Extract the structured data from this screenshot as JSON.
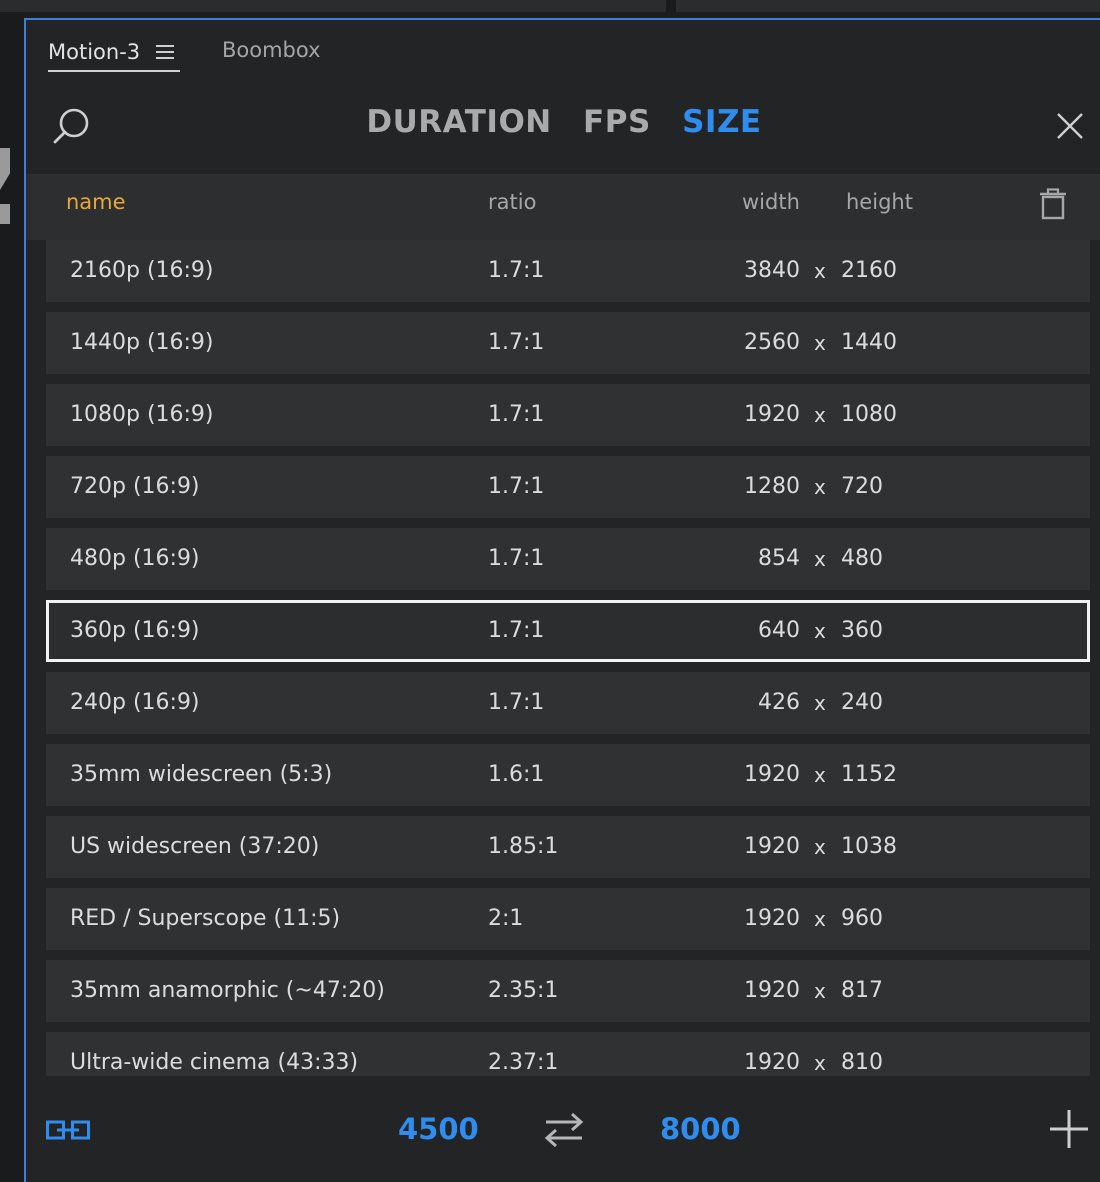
{
  "tabs": {
    "active": "Motion-3",
    "inactive": "Boombox"
  },
  "heading": {
    "duration": "DURATION",
    "fps": "FPS",
    "size": "SIZE"
  },
  "columns": {
    "name": "name",
    "ratio": "ratio",
    "width": "width",
    "height": "height"
  },
  "rows": [
    {
      "name": "2160p (16:9)",
      "ratio": "1.7:1",
      "width": "3840",
      "x": "x",
      "height": "2160"
    },
    {
      "name": "1440p (16:9)",
      "ratio": "1.7:1",
      "width": "2560",
      "x": "x",
      "height": "1440"
    },
    {
      "name": "1080p (16:9)",
      "ratio": "1.7:1",
      "width": "1920",
      "x": "x",
      "height": "1080"
    },
    {
      "name": "720p (16:9)",
      "ratio": "1.7:1",
      "width": "1280",
      "x": "x",
      "height": "720"
    },
    {
      "name": "480p (16:9)",
      "ratio": "1.7:1",
      "width": "854",
      "x": "x",
      "height": "480"
    },
    {
      "name": "360p (16:9)",
      "ratio": "1.7:1",
      "width": "640",
      "x": "x",
      "height": "360"
    },
    {
      "name": "240p (16:9)",
      "ratio": "1.7:1",
      "width": "426",
      "x": "x",
      "height": "240"
    },
    {
      "name": "35mm widescreen (5:3)",
      "ratio": "1.6:1",
      "width": "1920",
      "x": "x",
      "height": "1152"
    },
    {
      "name": "US widescreen (37:20)",
      "ratio": "1.85:1",
      "width": "1920",
      "x": "x",
      "height": "1038"
    },
    {
      "name": "RED / Superscope (11:5)",
      "ratio": "2:1",
      "width": "1920",
      "x": "x",
      "height": "960"
    },
    {
      "name": "35mm anamorphic (~47:20)",
      "ratio": "2.35:1",
      "width": "1920",
      "x": "x",
      "height": "817"
    },
    {
      "name": "Ultra-wide cinema (43:33)",
      "ratio": "2.37:1",
      "width": "1920",
      "x": "x",
      "height": "810"
    }
  ],
  "footer": {
    "width_value": "4500",
    "height_value": "8000"
  },
  "icons": {
    "search": "search-icon",
    "close": "close-icon",
    "trash": "trash-icon",
    "menu": "menu-icon",
    "link": "link-icon",
    "swap": "swap-icon",
    "add": "plus-icon"
  },
  "colors": {
    "accent": "#2f8df0",
    "name_header": "#e7a83a",
    "panel_border": "#3d7fd8",
    "selection": "#f2f2f2"
  }
}
